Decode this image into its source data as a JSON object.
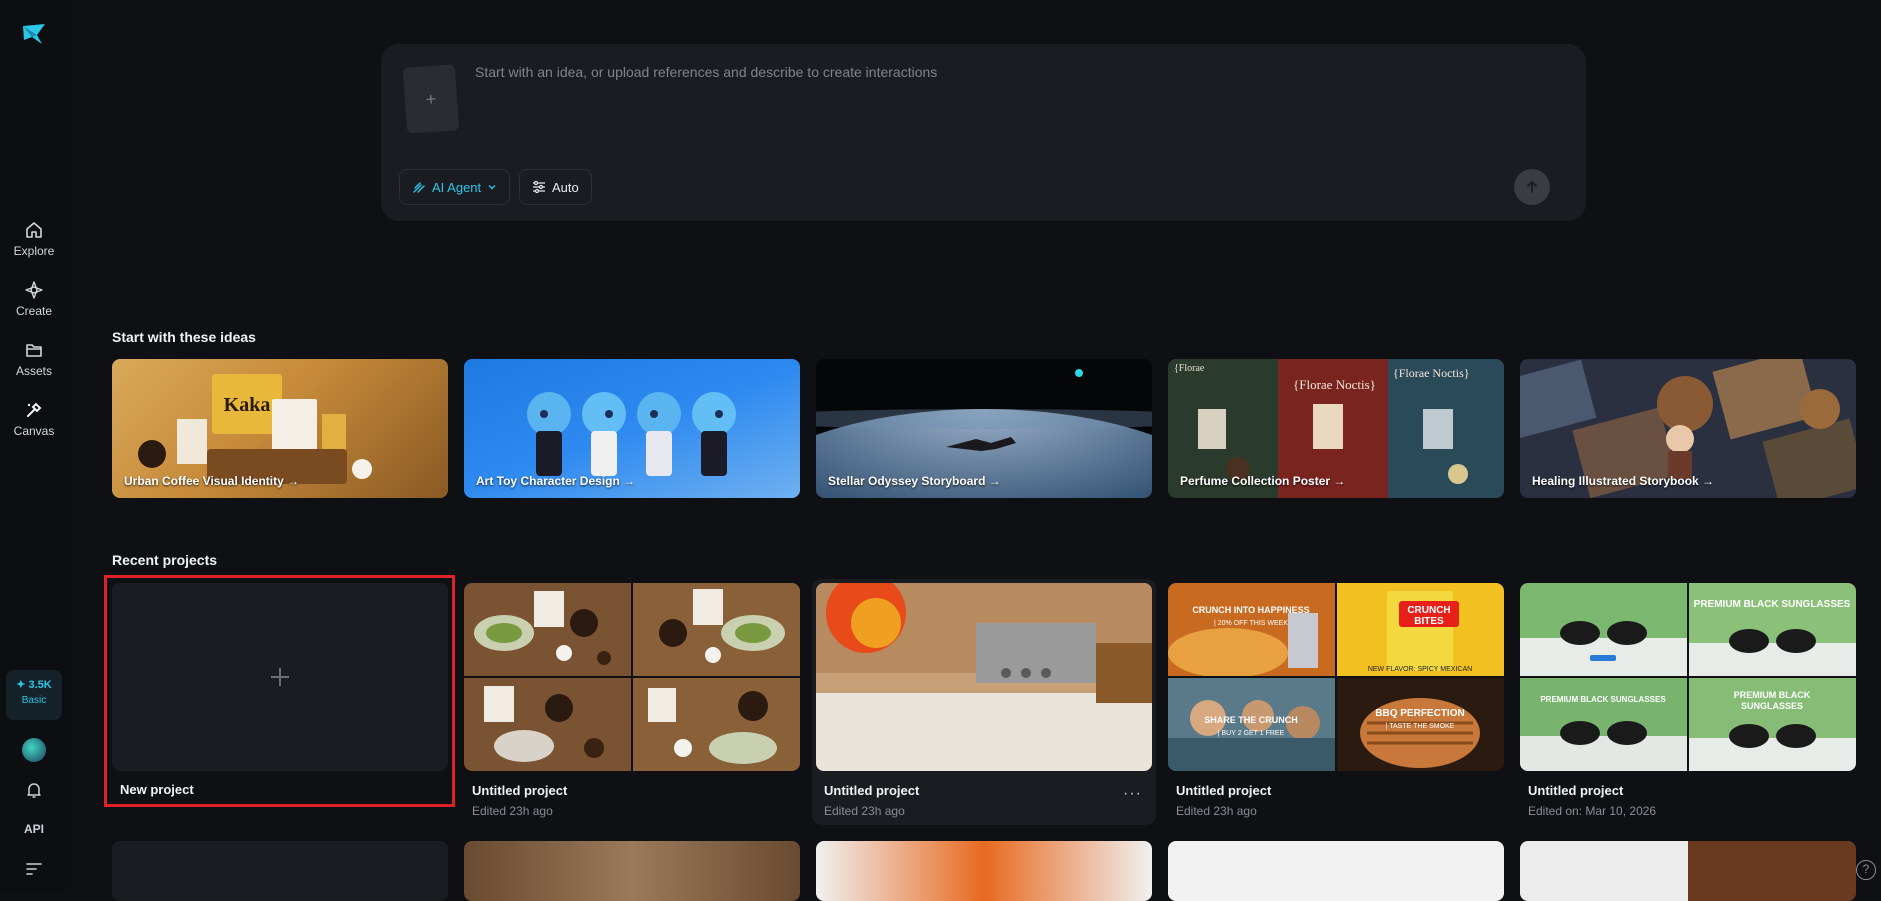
{
  "nav": {
    "items": [
      {
        "label": "Explore",
        "icon": "home-icon"
      },
      {
        "label": "Create",
        "icon": "diamond-icon"
      },
      {
        "label": "Assets",
        "icon": "folder-icon"
      },
      {
        "label": "Canvas",
        "icon": "canvas-icon"
      }
    ],
    "credits_amount": "✦ 3.5K",
    "plan": "Basic",
    "api_label": "API"
  },
  "prompt": {
    "placeholder": "Start with an idea, or upload references and describe to create interactions",
    "agent_label": "AI Agent",
    "auto_label": "Auto"
  },
  "ideas": {
    "title": "Start with these ideas",
    "cards": [
      {
        "label": "Urban Coffee Visual Identity →"
      },
      {
        "label": "Art Toy Character Design →"
      },
      {
        "label": "Stellar Odyssey Storyboard →"
      },
      {
        "label": "Perfume Collection Poster →"
      },
      {
        "label": "Healing Illustrated Storybook →"
      }
    ]
  },
  "recent": {
    "title": "Recent projects",
    "new_label": "New project",
    "projects": [
      {
        "title": "Untitled project",
        "edited": "Edited 23h ago"
      },
      {
        "title": "Untitled project",
        "edited": "Edited 23h ago"
      },
      {
        "title": "Untitled project",
        "edited": "Edited 23h ago"
      },
      {
        "title": "Untitled project",
        "edited": "Edited on: Mar 10, 2026"
      }
    ],
    "more_label": "···"
  },
  "colors": {
    "accent": "#2cc6e6",
    "highlight": "#e0202a",
    "background": "#0f1013"
  }
}
